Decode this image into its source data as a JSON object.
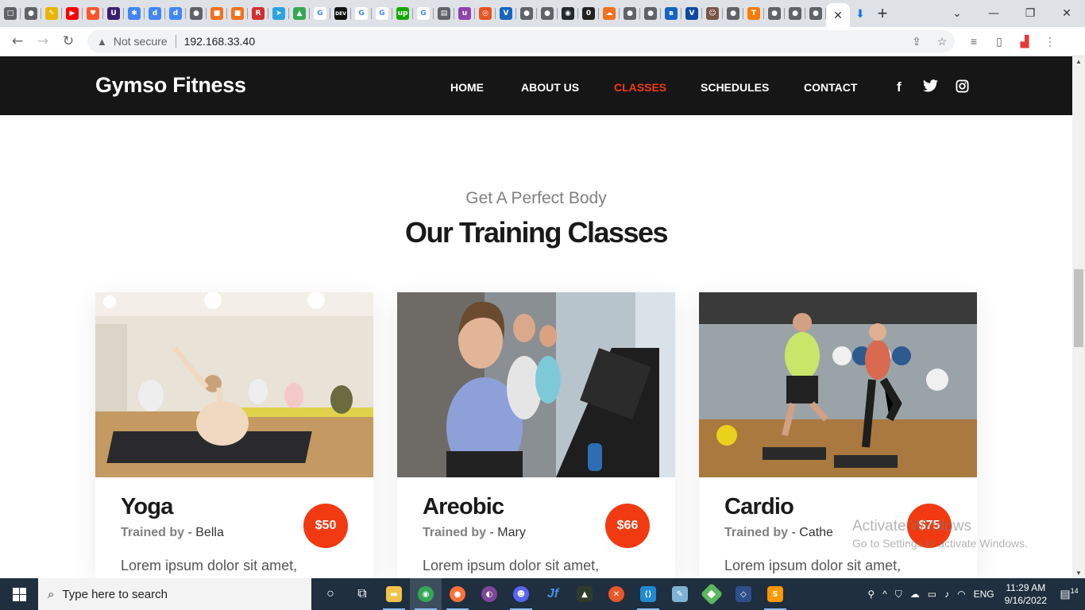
{
  "browser": {
    "tabs": [
      {
        "icon": "dialog-icon",
        "color": "#5f6368",
        "glyph": "□"
      },
      {
        "icon": "globe-icon",
        "color": "#5f6368",
        "glyph": "●"
      },
      {
        "icon": "edit-icon",
        "color": "#e8b500",
        "glyph": "✎"
      },
      {
        "icon": "youtube-icon",
        "color": "#ff0000",
        "glyph": "▶"
      },
      {
        "icon": "brave-icon",
        "color": "#fb542b",
        "glyph": "♥"
      },
      {
        "icon": "u-app-icon",
        "color": "#3c1e70",
        "glyph": "U"
      },
      {
        "icon": "pinwheel-icon",
        "color": "#4285f4",
        "glyph": "✱"
      },
      {
        "icon": "bitly-icon",
        "color": "#4285f4",
        "glyph": "d"
      },
      {
        "icon": "bitly-icon",
        "color": "#4285f4",
        "glyph": "d"
      },
      {
        "icon": "globe-icon",
        "color": "#5f6368",
        "glyph": "●"
      },
      {
        "icon": "cube-icon",
        "color": "#f2711c",
        "glyph": "■"
      },
      {
        "icon": "cube-icon",
        "color": "#f2711c",
        "glyph": "■"
      },
      {
        "icon": "r-app-icon",
        "color": "#d32f2f",
        "glyph": "R"
      },
      {
        "icon": "telegram-icon",
        "color": "#2aa3df",
        "glyph": "➤"
      },
      {
        "icon": "google-drive-icon",
        "color": "#34a853",
        "glyph": "▲"
      },
      {
        "icon": "google-icon",
        "color": "#ffffff",
        "glyph": "G"
      },
      {
        "icon": "dev-icon",
        "color": "#111111",
        "glyph": "DEV"
      },
      {
        "icon": "google-icon",
        "color": "#ffffff",
        "glyph": "G"
      },
      {
        "icon": "google-icon",
        "color": "#ffffff",
        "glyph": "G"
      },
      {
        "icon": "upwork-icon",
        "color": "#14a800",
        "glyph": "up"
      },
      {
        "icon": "google-icon",
        "color": "#ffffff",
        "glyph": "G"
      },
      {
        "icon": "book-icon",
        "color": "#5f6368",
        "glyph": "▤"
      },
      {
        "icon": "u-circle-icon",
        "color": "#8e44ad",
        "glyph": "u"
      },
      {
        "icon": "ubuntu-icon",
        "color": "#e95420",
        "glyph": "◎"
      },
      {
        "icon": "v-app-icon",
        "color": "#1565c0",
        "glyph": "V"
      },
      {
        "icon": "globe-icon",
        "color": "#5f6368",
        "glyph": "●"
      },
      {
        "icon": "globe-icon",
        "color": "#5f6368",
        "glyph": "●"
      },
      {
        "icon": "github-icon",
        "color": "#24292e",
        "glyph": "◉"
      },
      {
        "icon": "zero-app-icon",
        "color": "#222222",
        "glyph": "0"
      },
      {
        "icon": "cloud-icon",
        "color": "#f2711c",
        "glyph": "☁"
      },
      {
        "icon": "globe-icon",
        "color": "#5f6368",
        "glyph": "●"
      },
      {
        "icon": "globe-icon",
        "color": "#5f6368",
        "glyph": "●"
      },
      {
        "icon": "bluetooth-icon",
        "color": "#1565c0",
        "glyph": "ʙ"
      },
      {
        "icon": "v-app-icon",
        "color": "#0d47a1",
        "glyph": "V"
      },
      {
        "icon": "avatar-icon",
        "color": "#795548",
        "glyph": "☺"
      },
      {
        "icon": "globe-icon",
        "color": "#5f6368",
        "glyph": "●"
      },
      {
        "icon": "t-app-icon",
        "color": "#f57c00",
        "glyph": "T"
      },
      {
        "icon": "globe-icon",
        "color": "#5f6368",
        "glyph": "●"
      },
      {
        "icon": "globe-icon",
        "color": "#5f6368",
        "glyph": "●"
      },
      {
        "icon": "globe-icon",
        "color": "#5f6368",
        "glyph": "●"
      }
    ],
    "close_tab_glyph": "✕",
    "download_glyph": "⬇",
    "new_tab_glyph": "+",
    "window_controls": [
      "⌄",
      "—",
      "❐",
      "✕"
    ],
    "security_label": "Not secure",
    "url": "192.168.33.40"
  },
  "site": {
    "brand": "Gymso Fitness",
    "nav": [
      {
        "label": "HOME",
        "active": false
      },
      {
        "label": "ABOUT US",
        "active": false
      },
      {
        "label": "CLASSES",
        "active": true
      },
      {
        "label": "SCHEDULES",
        "active": false
      },
      {
        "label": "CONTACT",
        "active": false
      }
    ],
    "social": [
      "f",
      "t",
      "ig"
    ],
    "section": {
      "subtitle": "Get A Perfect Body",
      "title": "Our Training Classes"
    },
    "classes": [
      {
        "name": "Yoga",
        "trained_by_label": "Trained by",
        "trainer": "- Bella",
        "price": "$50",
        "description": "Lorem ipsum dolor sit amet,"
      },
      {
        "name": "Areobic",
        "trained_by_label": "Trained by",
        "trainer": "- Mary",
        "price": "$66",
        "description": "Lorem ipsum dolor sit amet,"
      },
      {
        "name": "Cardio",
        "trained_by_label": "Trained by",
        "trainer": "- Cathe",
        "price": "$75",
        "description": "Lorem ipsum dolor sit amet,"
      }
    ],
    "accent_color": "#f13a11",
    "header_bg": "#161616"
  },
  "watermark": {
    "line1": "Activate Windows",
    "line2": "Go to Settings to activate Windows."
  },
  "taskbar": {
    "search_placeholder": "Type here to search",
    "language": "ENG",
    "time": "11:29 AM",
    "date": "9/16/2022",
    "notification_count": "14"
  }
}
